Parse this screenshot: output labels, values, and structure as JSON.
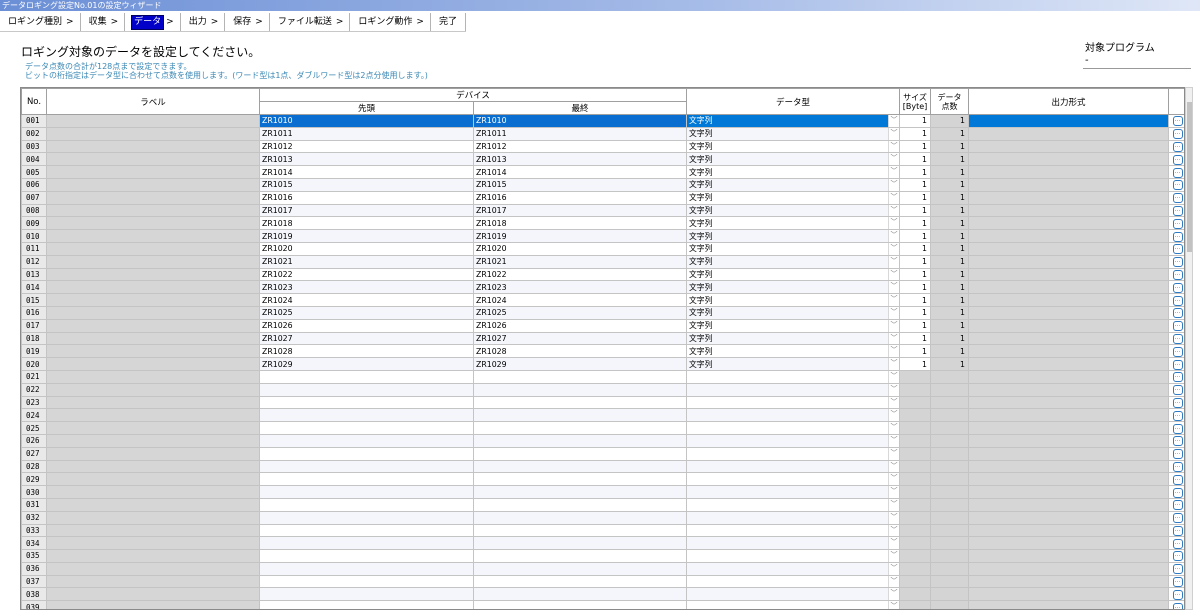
{
  "window": {
    "title": "データロギング設定No.01の設定ウィザード"
  },
  "steps": [
    {
      "label": "ロギング種別",
      "active": false
    },
    {
      "label": "収集",
      "active": false
    },
    {
      "label": "データ",
      "active": true
    },
    {
      "label": "出力",
      "active": false
    },
    {
      "label": "保存",
      "active": false
    },
    {
      "label": "ファイル転送",
      "active": false
    },
    {
      "label": "ロギング動作",
      "active": false
    },
    {
      "label": "完了",
      "active": false
    }
  ],
  "step_separator": ">",
  "heading": "ロギング対象のデータを設定してください。",
  "notes": [
    "データ点数の合計が128点まで設定できます。",
    "ビットの桁指定はデータ型に合わせて点数を使用します。(ワード型は1点、ダブルワード型は2点分使用します。)"
  ],
  "target_program": {
    "label": "対象プログラム",
    "value": "-"
  },
  "table": {
    "headers": {
      "no": "No.",
      "label": "ラベル",
      "device": "デバイス",
      "device_start": "先頭",
      "device_end": "最終",
      "data_type": "データ型",
      "size_line1": "サイズ",
      "size_line2": "[Byte]",
      "count_line1": "データ",
      "count_line2": "点数",
      "output_format": "出力形式"
    },
    "dropdown_glyph": "﹀",
    "ellipsis_glyph": "...",
    "rows": [
      {
        "no": "001",
        "start": "ZR1010",
        "end": "ZR1010",
        "type": "文字列",
        "size": "1",
        "count": "1"
      },
      {
        "no": "002",
        "start": "ZR1011",
        "end": "ZR1011",
        "type": "文字列",
        "size": "1",
        "count": "1"
      },
      {
        "no": "003",
        "start": "ZR1012",
        "end": "ZR1012",
        "type": "文字列",
        "size": "1",
        "count": "1"
      },
      {
        "no": "004",
        "start": "ZR1013",
        "end": "ZR1013",
        "type": "文字列",
        "size": "1",
        "count": "1"
      },
      {
        "no": "005",
        "start": "ZR1014",
        "end": "ZR1014",
        "type": "文字列",
        "size": "1",
        "count": "1"
      },
      {
        "no": "006",
        "start": "ZR1015",
        "end": "ZR1015",
        "type": "文字列",
        "size": "1",
        "count": "1"
      },
      {
        "no": "007",
        "start": "ZR1016",
        "end": "ZR1016",
        "type": "文字列",
        "size": "1",
        "count": "1"
      },
      {
        "no": "008",
        "start": "ZR1017",
        "end": "ZR1017",
        "type": "文字列",
        "size": "1",
        "count": "1"
      },
      {
        "no": "009",
        "start": "ZR1018",
        "end": "ZR1018",
        "type": "文字列",
        "size": "1",
        "count": "1"
      },
      {
        "no": "010",
        "start": "ZR1019",
        "end": "ZR1019",
        "type": "文字列",
        "size": "1",
        "count": "1"
      },
      {
        "no": "011",
        "start": "ZR1020",
        "end": "ZR1020",
        "type": "文字列",
        "size": "1",
        "count": "1"
      },
      {
        "no": "012",
        "start": "ZR1021",
        "end": "ZR1021",
        "type": "文字列",
        "size": "1",
        "count": "1"
      },
      {
        "no": "013",
        "start": "ZR1022",
        "end": "ZR1022",
        "type": "文字列",
        "size": "1",
        "count": "1"
      },
      {
        "no": "014",
        "start": "ZR1023",
        "end": "ZR1023",
        "type": "文字列",
        "size": "1",
        "count": "1"
      },
      {
        "no": "015",
        "start": "ZR1024",
        "end": "ZR1024",
        "type": "文字列",
        "size": "1",
        "count": "1"
      },
      {
        "no": "016",
        "start": "ZR1025",
        "end": "ZR1025",
        "type": "文字列",
        "size": "1",
        "count": "1"
      },
      {
        "no": "017",
        "start": "ZR1026",
        "end": "ZR1026",
        "type": "文字列",
        "size": "1",
        "count": "1"
      },
      {
        "no": "018",
        "start": "ZR1027",
        "end": "ZR1027",
        "type": "文字列",
        "size": "1",
        "count": "1"
      },
      {
        "no": "019",
        "start": "ZR1028",
        "end": "ZR1028",
        "type": "文字列",
        "size": "1",
        "count": "1"
      },
      {
        "no": "020",
        "start": "ZR1029",
        "end": "ZR1029",
        "type": "文字列",
        "size": "1",
        "count": "1"
      },
      {
        "no": "021",
        "start": "",
        "end": "",
        "type": "",
        "size": "",
        "count": ""
      },
      {
        "no": "022",
        "start": "",
        "end": "",
        "type": "",
        "size": "",
        "count": ""
      },
      {
        "no": "023",
        "start": "",
        "end": "",
        "type": "",
        "size": "",
        "count": ""
      },
      {
        "no": "024",
        "start": "",
        "end": "",
        "type": "",
        "size": "",
        "count": ""
      },
      {
        "no": "025",
        "start": "",
        "end": "",
        "type": "",
        "size": "",
        "count": ""
      },
      {
        "no": "026",
        "start": "",
        "end": "",
        "type": "",
        "size": "",
        "count": ""
      },
      {
        "no": "027",
        "start": "",
        "end": "",
        "type": "",
        "size": "",
        "count": ""
      },
      {
        "no": "028",
        "start": "",
        "end": "",
        "type": "",
        "size": "",
        "count": ""
      },
      {
        "no": "029",
        "start": "",
        "end": "",
        "type": "",
        "size": "",
        "count": ""
      },
      {
        "no": "030",
        "start": "",
        "end": "",
        "type": "",
        "size": "",
        "count": ""
      },
      {
        "no": "031",
        "start": "",
        "end": "",
        "type": "",
        "size": "",
        "count": ""
      },
      {
        "no": "032",
        "start": "",
        "end": "",
        "type": "",
        "size": "",
        "count": ""
      },
      {
        "no": "033",
        "start": "",
        "end": "",
        "type": "",
        "size": "",
        "count": ""
      },
      {
        "no": "034",
        "start": "",
        "end": "",
        "type": "",
        "size": "",
        "count": ""
      },
      {
        "no": "035",
        "start": "",
        "end": "",
        "type": "",
        "size": "",
        "count": ""
      },
      {
        "no": "036",
        "start": "",
        "end": "",
        "type": "",
        "size": "",
        "count": ""
      },
      {
        "no": "037",
        "start": "",
        "end": "",
        "type": "",
        "size": "",
        "count": ""
      },
      {
        "no": "038",
        "start": "",
        "end": "",
        "type": "",
        "size": "",
        "count": ""
      },
      {
        "no": "039",
        "start": "",
        "end": "",
        "type": "",
        "size": "",
        "count": ""
      }
    ]
  },
  "colors": {
    "selection": "#0078d7",
    "active_step": "#0000c8",
    "note_text": "#3b88b5"
  }
}
